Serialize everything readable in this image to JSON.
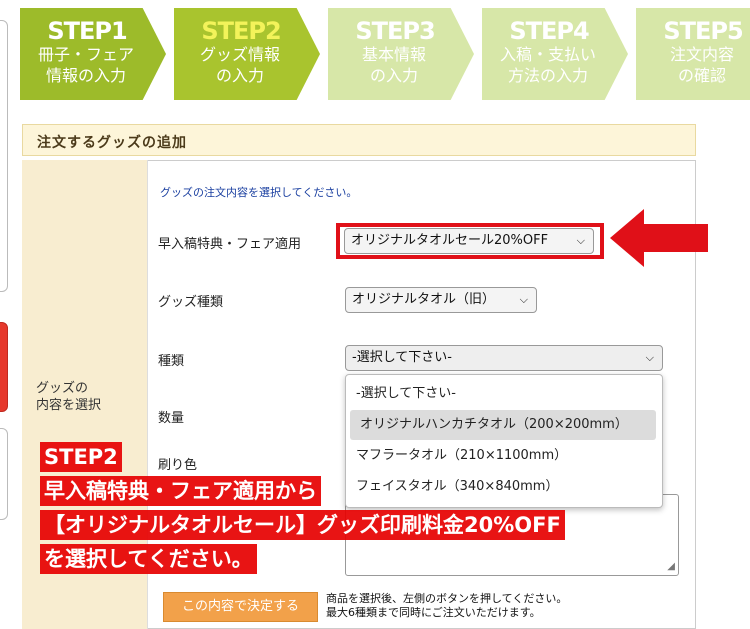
{
  "steps": [
    {
      "num": "STEP1",
      "line1": "冊子・フェア",
      "line2": "情報の入力"
    },
    {
      "num": "STEP2",
      "line1": "グッズ情報",
      "line2": "の入力"
    },
    {
      "num": "STEP3",
      "line1": "基本情報",
      "line2": "の入力"
    },
    {
      "num": "STEP4",
      "line1": "入稿・支払い",
      "line2": "方法の入力"
    },
    {
      "num": "STEP5",
      "line1": "注文内容",
      "line2": "の確認"
    }
  ],
  "section": {
    "title": "注文するグッズの追加"
  },
  "form": {
    "side_label_1": "グッズの",
    "side_label_2": "内容を選択",
    "hint": "グッズの注文内容を選択してください。",
    "fair_label": "早入稿特典・フェア適用",
    "fair_value": "オリジナルタオルセール20%OFF",
    "goods_type_label": "グッズ種類",
    "goods_type_value": "オリジナルタオル（旧）",
    "kind_label": "種類",
    "kind_value": "-選択して下さい-",
    "qty_label": "数量",
    "color_label": "刷り色",
    "dropdown_options": [
      "-選択して下さい-",
      "オリジナルハンカチタオル（200×200mm）",
      "マフラータオル（210×1100mm）",
      "フェイスタオル（340×840mm）"
    ],
    "confirm_button": "この内容で決定する",
    "note_1": "商品を選択後、左側のボタンを押してください。",
    "note_2": "最大6種類まで同時にご注文いただけます。"
  },
  "overlay": {
    "line1": "STEP2",
    "line2": "早入稿特典・フェア適用から",
    "line3": "【オリジナルタオルセール】グッズ印刷料金20%OFF",
    "line4": "を選択してください。"
  },
  "colors": {
    "step_active": "#a9c42e",
    "step_inactive": "#d7e7a8",
    "highlight": "#e01018",
    "overlay": "#e60000",
    "button": "#f2a14a"
  }
}
